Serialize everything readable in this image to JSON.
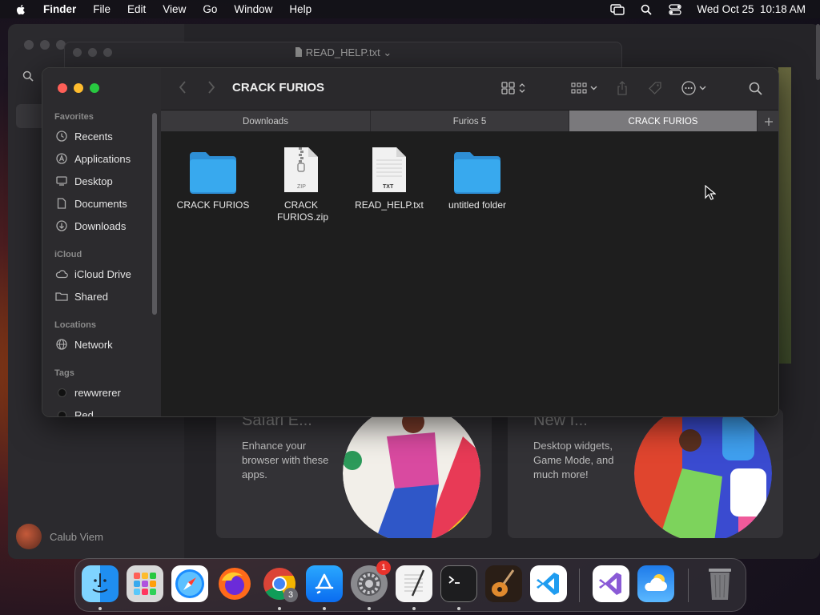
{
  "menubar": {
    "app_name": "Finder",
    "menus": [
      "File",
      "Edit",
      "View",
      "Go",
      "Window",
      "Help"
    ],
    "datetime": "Wed Oct 25  10:18 AM"
  },
  "background_window": {
    "user_name": "Calub Viem",
    "cards": [
      {
        "title": "Safari E...",
        "text": "Enhance your browser with these apps."
      },
      {
        "title": "New I...",
        "text": "Desktop widgets, Game Mode, and much more!"
      }
    ]
  },
  "editor_window": {
    "title": "READ_HELP.txt"
  },
  "finder": {
    "title": "CRACK FURIOS",
    "sidebar": {
      "favorites_label": "Favorites",
      "favorites": [
        "Recents",
        "Applications",
        "Desktop",
        "Documents",
        "Downloads"
      ],
      "icloud_label": "iCloud",
      "icloud": [
        "iCloud Drive",
        "Shared"
      ],
      "locations_label": "Locations",
      "locations": [
        "Network"
      ],
      "tags_label": "Tags",
      "tags": [
        {
          "name": "rewwrerer",
          "color": "#1a1a1a"
        },
        {
          "name": "Red",
          "color": "#1a1a1a"
        }
      ]
    },
    "tabs": [
      "Downloads",
      "Furios 5",
      "CRACK FURIOS"
    ],
    "active_tab": "CRACK FURIOS",
    "files": [
      {
        "name": "CRACK FURIOS",
        "type": "folder"
      },
      {
        "name": "CRACK FURIOS.zip",
        "type": "zip",
        "badge": "ZIP"
      },
      {
        "name": "READ_HELP.txt",
        "type": "txt",
        "badge": "TXT"
      },
      {
        "name": "untitled folder",
        "type": "folder"
      }
    ]
  },
  "dock": {
    "apps": [
      "Finder",
      "Launchpad",
      "Safari",
      "Firefox",
      "Chrome",
      "App Store",
      "System Settings",
      "TextEdit",
      "Terminal",
      "GarageBand",
      "Visual Studio Code",
      "Visual Studio",
      "Weather",
      "Trash"
    ],
    "settings_badge": "1",
    "chrome_badge": "3"
  },
  "colors": {
    "accent_folder": "#38a9ee",
    "close": "#fe5f57",
    "minimize": "#febc2e",
    "zoom": "#28c840"
  }
}
